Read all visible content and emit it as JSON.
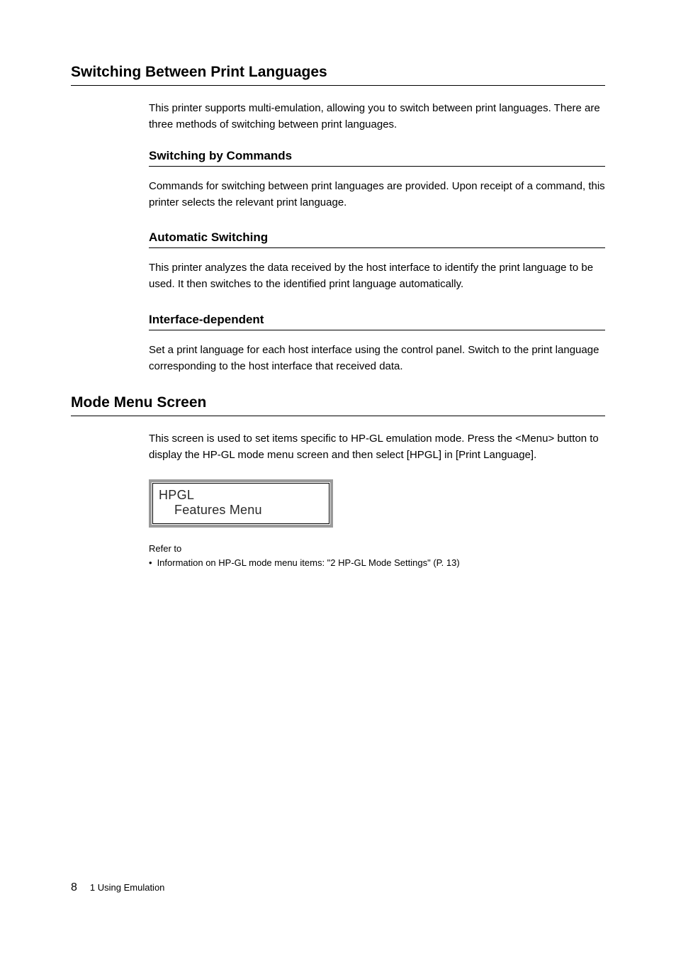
{
  "section1": {
    "heading": "Switching Between Print Languages",
    "intro": "This printer supports multi-emulation, allowing you to switch between print languages. There are three methods of switching between print languages.",
    "sub1": {
      "heading": "Switching by Commands",
      "body": "Commands for switching between print languages are provided. Upon receipt of a command, this printer selects the relevant print language."
    },
    "sub2": {
      "heading": "Automatic Switching",
      "body": "This printer analyzes the data received by the host interface to identify the print language to be used. It then switches to the identified print language automatically."
    },
    "sub3": {
      "heading": "Interface-dependent",
      "body": "Set a print language for each host interface using the control panel. Switch to the print language corresponding to the host interface that received data."
    }
  },
  "section2": {
    "heading": "Mode Menu Screen",
    "intro": "This screen is used to set items specific to HP-GL emulation mode. Press the <Menu> button to display the HP-GL mode menu screen and then select [HPGL] in [Print Language].",
    "screen": {
      "line1": "HPGL",
      "line2": "Features Menu"
    },
    "refer_label": "Refer to",
    "bullet_text": "Information on HP-GL mode menu items: \"2 HP-GL Mode Settings\" (P. 13)"
  },
  "footer": {
    "page_number": "8",
    "chapter": "1 Using Emulation"
  }
}
